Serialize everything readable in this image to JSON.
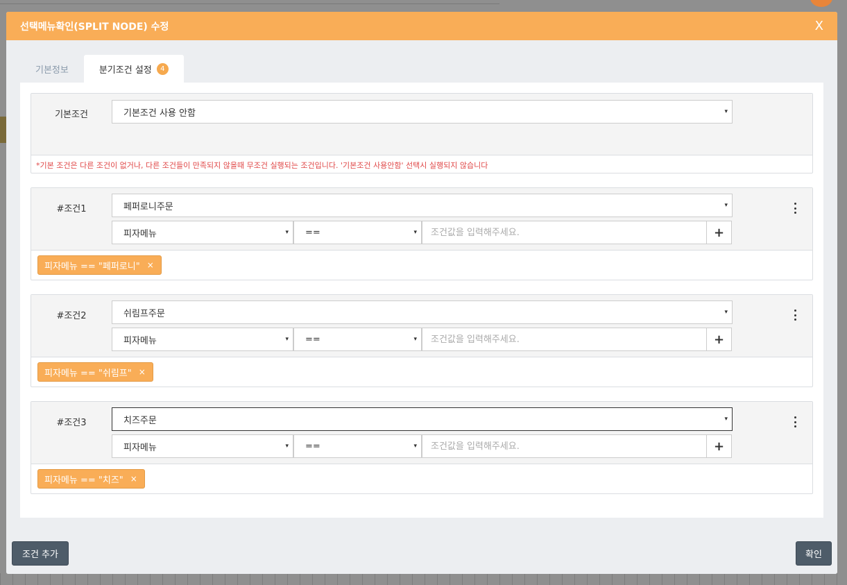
{
  "modal": {
    "title": "선택메뉴확인(SPLIT NODE) 수정",
    "close_label": "X"
  },
  "tabs": [
    {
      "label": "기본정보",
      "active": false
    },
    {
      "label": "분기조건 설정",
      "active": true,
      "badge": "4"
    }
  ],
  "default_condition": {
    "label": "기본조건",
    "selected": "기본조건 사용 안함",
    "note": "*기본 조건은 다른 조건이 없거나, 다른 조건들이 만족되지 않을때 무조건 실행되는 조건입니다. '기본조건 사용안함' 선택시 실행되지 않습니다"
  },
  "conditions": [
    {
      "label": "#조건1",
      "target": "페퍼로니주문",
      "field": "피자메뉴",
      "operator": "==",
      "value_placeholder": "조건값을 입력해주세요.",
      "tag": "피자메뉴 == \"페퍼로니\""
    },
    {
      "label": "#조건2",
      "target": "쉬림프주문",
      "field": "피자메뉴",
      "operator": "==",
      "value_placeholder": "조건값을 입력해주세요.",
      "tag": "피자메뉴 == \"쉬림프\""
    },
    {
      "label": "#조건3",
      "target": "치즈주문",
      "field": "피자메뉴",
      "operator": "==",
      "value_placeholder": "조건값을 입력해주세요.",
      "tag": "피자메뉴 == \"치즈\""
    }
  ],
  "icons": {
    "caret": "▾",
    "plus": "+",
    "tag_remove": "×",
    "more": "more-vertical-icon"
  },
  "footer": {
    "add_condition_label": "조건 추가",
    "confirm_label": "확인"
  },
  "colors": {
    "header": "#f9ad57",
    "tag": "#f9ad57",
    "badge": "#f6a94e",
    "footer_button": "#4e5c69",
    "note_text": "#e04848"
  }
}
